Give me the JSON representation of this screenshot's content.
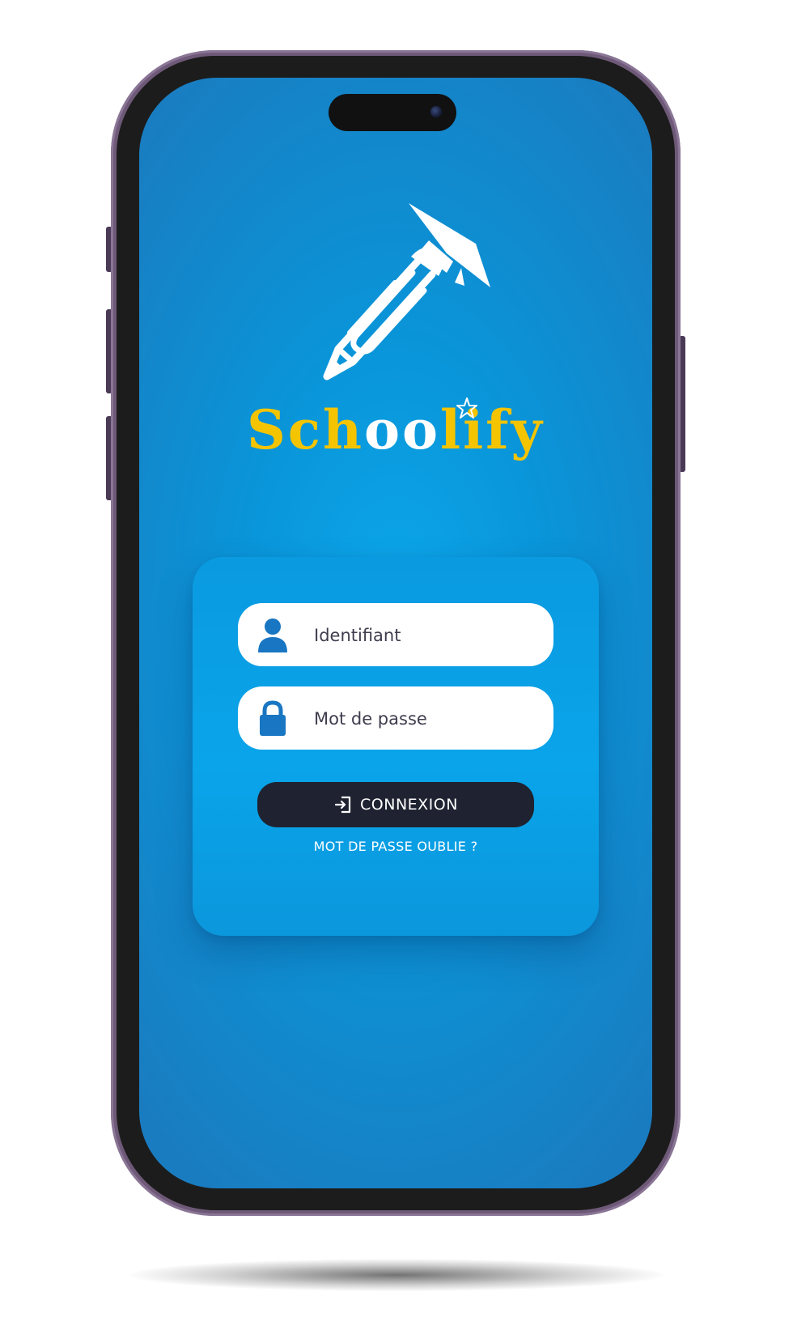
{
  "app": {
    "name_part1": "Sch",
    "name_part2": "oo",
    "name_part3": "lify"
  },
  "login": {
    "username_placeholder": "Identifiant",
    "password_placeholder": "Mot de passe",
    "submit_label": "CONNEXION",
    "forgot_link": "MOT DE PASSE OUBLIE ?"
  },
  "icons": {
    "logo": "pencil-graduation-cap-icon",
    "username": "user-icon",
    "password": "lock-icon",
    "submit": "login-icon",
    "camera": "camera-icon"
  },
  "colors": {
    "primary_blue": "#0aa0e6",
    "brand_yellow": "#f5c400",
    "button_dark": "#1f2230",
    "icon_blue": "#1976c2",
    "frame_purple": "#6e5978"
  }
}
